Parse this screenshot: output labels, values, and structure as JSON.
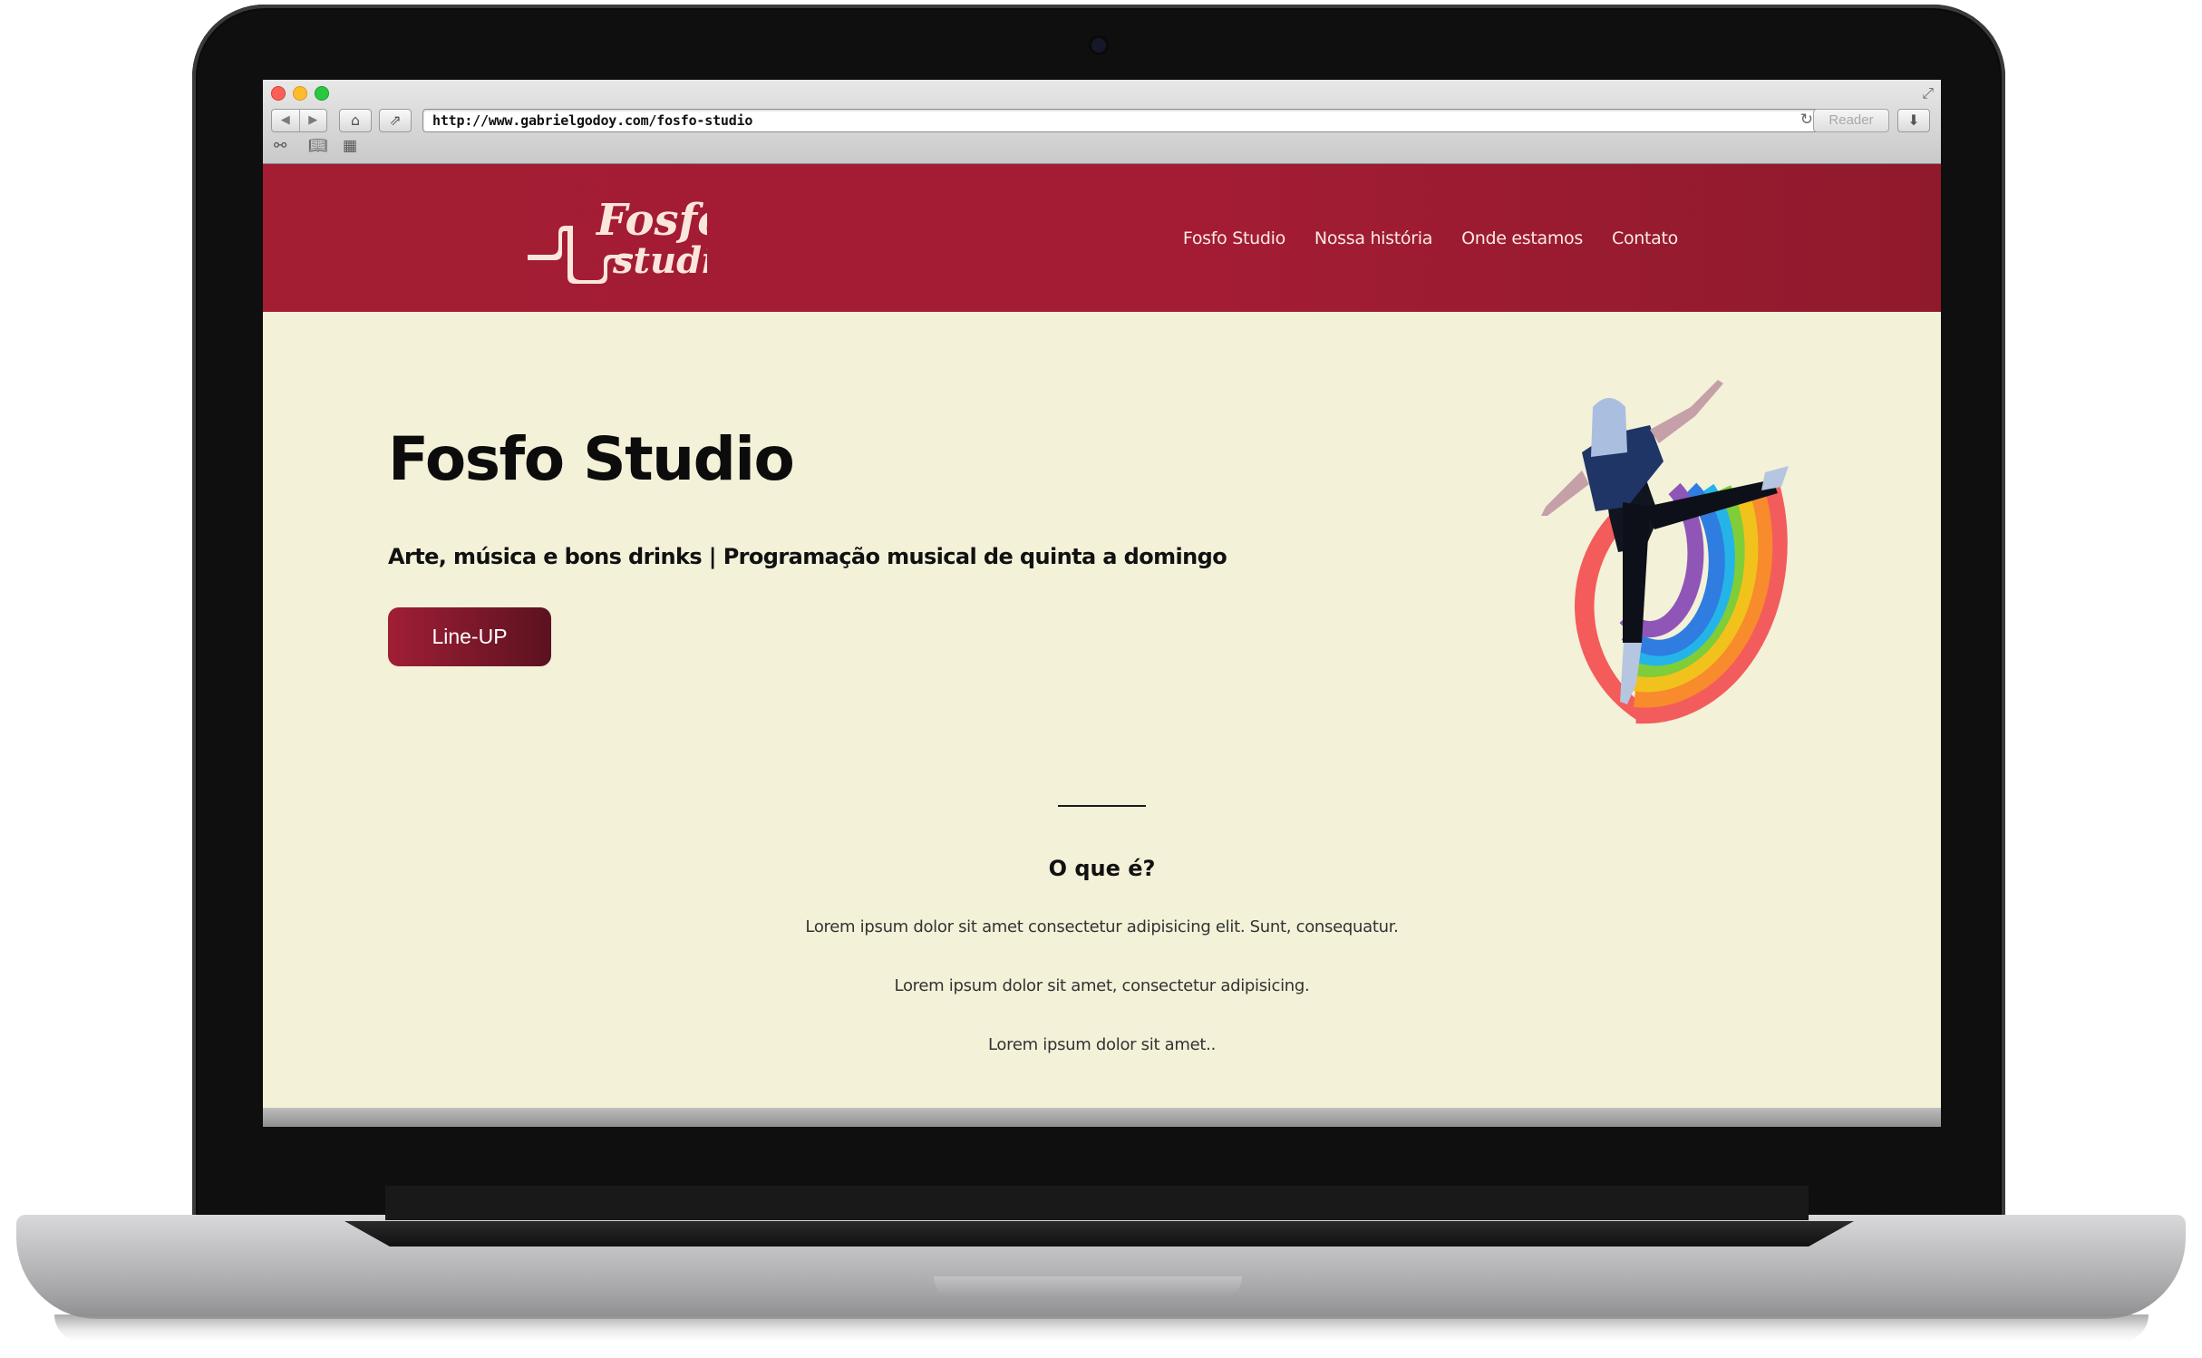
{
  "browser": {
    "url": "http://www.gabrielgodoy.com/fosfo-studio",
    "reader_label": "Reader",
    "icons": {
      "back": "back-arrow-icon",
      "forward": "forward-arrow-icon",
      "home": "home-icon",
      "share": "share-icon",
      "reload": "reload-icon",
      "download": "download-icon",
      "reading_list": "glasses-icon",
      "bookmarks": "book-icon",
      "top_sites": "grid-icon"
    }
  },
  "site": {
    "logo_text": "Fosfo studio",
    "nav": [
      "Fosfo Studio",
      "Nossa história",
      "Onde estamos",
      "Contato"
    ],
    "hero": {
      "title": "Fosfo Studio",
      "subtitle": "Arte, música e bons drinks | Programação musical de quinta a domingo",
      "cta_label": "Line-UP"
    },
    "section": {
      "title": "O que é?",
      "paragraphs": [
        "Lorem ipsum dolor sit amet consectetur adipisicing elit. Sunt, consequatur.",
        "Lorem ipsum dolor sit amet, consectetur adipisicing.",
        "Lorem ipsum dolor sit amet.."
      ]
    }
  },
  "colors": {
    "header_red": "#a31d33",
    "page_bg": "#f3f1d8",
    "button_gradient_start": "#a01e36",
    "button_gradient_end": "#5b1220"
  }
}
